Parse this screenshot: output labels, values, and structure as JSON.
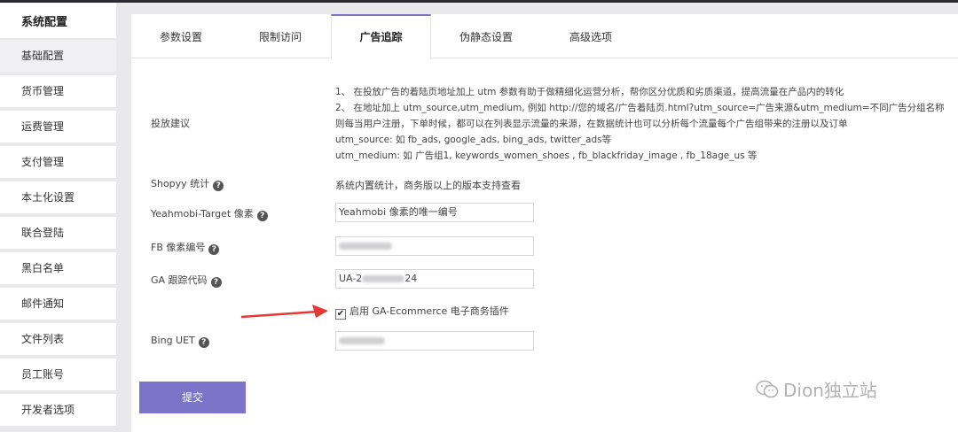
{
  "sidebar": {
    "title": "系统配置",
    "items": [
      {
        "label": "基础配置",
        "active": true
      },
      {
        "label": "货币管理"
      },
      {
        "label": "运费管理"
      },
      {
        "label": "支付管理"
      },
      {
        "label": "本土化设置"
      },
      {
        "label": "联合登陆"
      },
      {
        "label": "黑白名单"
      },
      {
        "label": "邮件通知"
      },
      {
        "label": "文件列表"
      },
      {
        "label": "员工账号"
      },
      {
        "label": "开发者选项"
      }
    ]
  },
  "tabs": [
    "参数设置",
    "限制访问",
    "广告追踪",
    "伪静态设置",
    "高级选项"
  ],
  "active_tab": "广告追踪",
  "form": {
    "advice_label": "投放建议",
    "advice_lines": [
      "1、 在投放广告的着陆页地址加上 utm 参数有助于做精细化运营分析，帮你区分优质和劣质渠道，提高流量在产品内的转化",
      "2、 在地址加上 utm_source,utm_medium, 例如 http://您的域名/广告着陆页.html?utm_source=广告来源&utm_medium=不同广告分组名称",
      "则每当用户注册，下单时候，都可以在列表显示流量的来源，在数据统计也可以分析每个流量每个广告组带来的注册以及订单",
      "utm_source: 如 fb_ads, google_ads, bing_ads, twitter_ads等",
      "utm_medium: 如 广告组1, keywords_women_shoes , fb_blackfriday_image , fb_18age_us 等"
    ],
    "shopyy_label": "Shopyy 统计",
    "shopyy_value": "系统内置统计，商务版以上的版本支持查看",
    "yeahmobi_label": "Yeahmobi-Target 像素",
    "yeahmobi_placeholder": "Yeahmobi 像素的唯一编号",
    "fb_label": "FB 像素编号",
    "ga_label": "GA 跟踪代码",
    "ga_value_start": "UA-2",
    "ga_value_end": "24",
    "ga_ecommerce_label": "启用 GA-Ecommerce 电子商务插件",
    "ga_ecommerce_checked": true,
    "bing_label": "Bing UET",
    "help_glyph": "?",
    "check_glyph": "✔"
  },
  "submit_label": "提交",
  "watermark": "Dion独立站",
  "colors": {
    "accent": "#7b75c9",
    "arrow": "#e53935"
  }
}
